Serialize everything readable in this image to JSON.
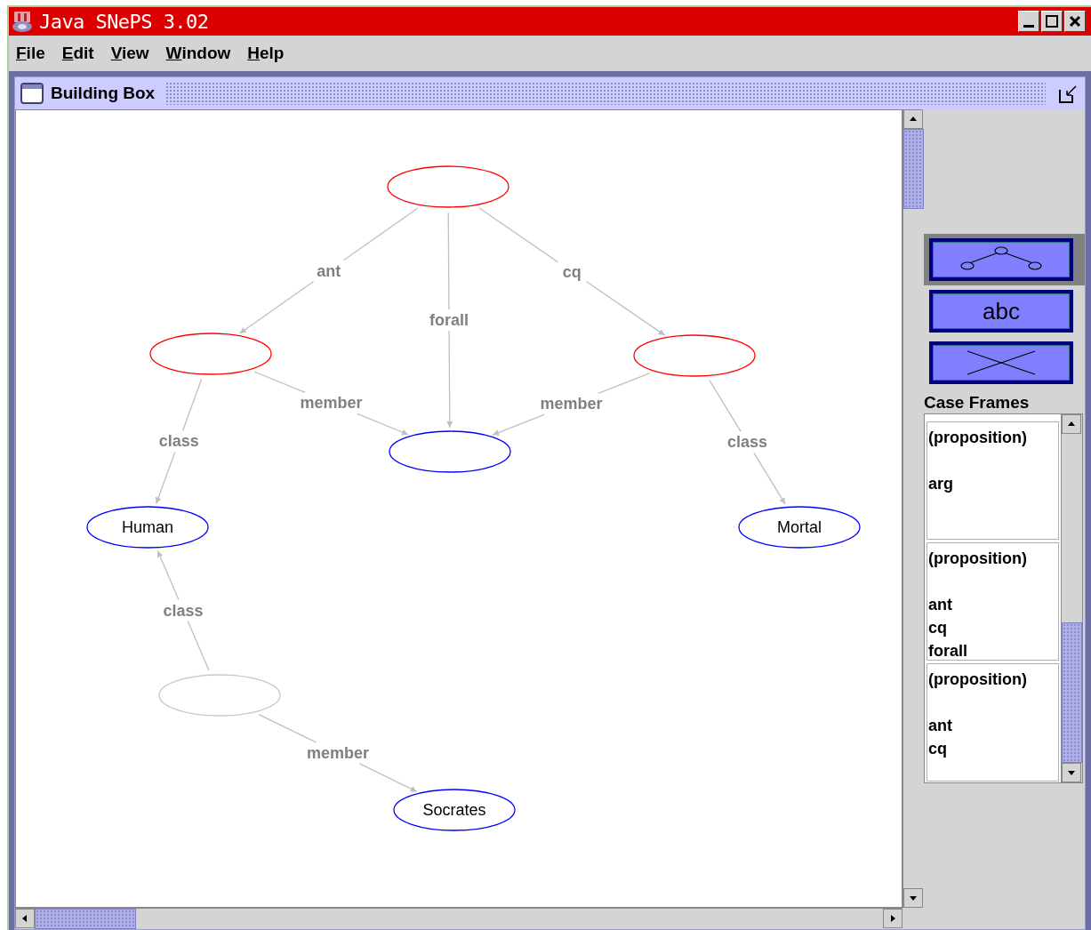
{
  "window": {
    "title": "Java SNePS 3.02"
  },
  "menu": [
    "File",
    "Edit",
    "View",
    "Window",
    "Help"
  ],
  "frame": {
    "title": "Building Box"
  },
  "graph": {
    "nodes": [
      {
        "color": "#ff0000"
      },
      {
        "color": "#ff0000"
      },
      {
        "color": "#ff0000"
      },
      {
        "color": "#0000ff"
      },
      {
        "color": "#0000ff",
        "label": "Human"
      },
      {
        "color": "#0000ff",
        "label": "Mortal"
      },
      {
        "color": "#c8c8c8"
      },
      {
        "color": "#0000ff",
        "label": "Socrates"
      }
    ],
    "edges": [
      {
        "label": "ant"
      },
      {
        "label": "forall"
      },
      {
        "label": "cq"
      },
      {
        "label": "member"
      },
      {
        "label": "member"
      },
      {
        "label": "class"
      },
      {
        "label": "class"
      },
      {
        "label": "class"
      },
      {
        "label": "member"
      }
    ]
  },
  "tools": [
    {
      "kind": "tree",
      "selected": true
    },
    {
      "kind": "text",
      "label": "abc",
      "selected": false
    },
    {
      "kind": "delete",
      "selected": false
    }
  ],
  "case_frames": {
    "title": "Case Frames",
    "items": [
      {
        "type": "(proposition)",
        "slots": [
          "arg"
        ]
      },
      {
        "type": "(proposition)",
        "slots": [
          "ant",
          "cq",
          "forall"
        ]
      },
      {
        "type": "(proposition)",
        "slots": [
          "ant",
          "cq"
        ]
      }
    ]
  }
}
